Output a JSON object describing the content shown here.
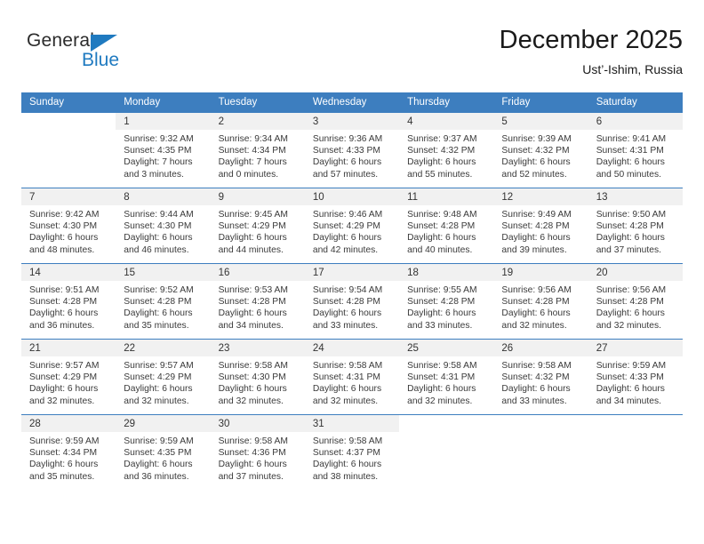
{
  "logo": {
    "word1": "General",
    "word2": "Blue",
    "triangle_color": "#1f7ac0"
  },
  "header": {
    "title": "December 2025",
    "subtitle": "Ust’-Ishim, Russia"
  },
  "theme": {
    "header_blue": "#3d7ebf",
    "daynum_band": "#f1f1f1",
    "text": "#3a3a3a"
  },
  "weekday_headers": [
    "Sunday",
    "Monday",
    "Tuesday",
    "Wednesday",
    "Thursday",
    "Friday",
    "Saturday"
  ],
  "weeks": [
    [
      {
        "day": "",
        "sunrise": "",
        "sunset": "",
        "daylight1": "",
        "daylight2": ""
      },
      {
        "day": "1",
        "sunrise": "Sunrise: 9:32 AM",
        "sunset": "Sunset: 4:35 PM",
        "daylight1": "Daylight: 7 hours",
        "daylight2": "and 3 minutes."
      },
      {
        "day": "2",
        "sunrise": "Sunrise: 9:34 AM",
        "sunset": "Sunset: 4:34 PM",
        "daylight1": "Daylight: 7 hours",
        "daylight2": "and 0 minutes."
      },
      {
        "day": "3",
        "sunrise": "Sunrise: 9:36 AM",
        "sunset": "Sunset: 4:33 PM",
        "daylight1": "Daylight: 6 hours",
        "daylight2": "and 57 minutes."
      },
      {
        "day": "4",
        "sunrise": "Sunrise: 9:37 AM",
        "sunset": "Sunset: 4:32 PM",
        "daylight1": "Daylight: 6 hours",
        "daylight2": "and 55 minutes."
      },
      {
        "day": "5",
        "sunrise": "Sunrise: 9:39 AM",
        "sunset": "Sunset: 4:32 PM",
        "daylight1": "Daylight: 6 hours",
        "daylight2": "and 52 minutes."
      },
      {
        "day": "6",
        "sunrise": "Sunrise: 9:41 AM",
        "sunset": "Sunset: 4:31 PM",
        "daylight1": "Daylight: 6 hours",
        "daylight2": "and 50 minutes."
      }
    ],
    [
      {
        "day": "7",
        "sunrise": "Sunrise: 9:42 AM",
        "sunset": "Sunset: 4:30 PM",
        "daylight1": "Daylight: 6 hours",
        "daylight2": "and 48 minutes."
      },
      {
        "day": "8",
        "sunrise": "Sunrise: 9:44 AM",
        "sunset": "Sunset: 4:30 PM",
        "daylight1": "Daylight: 6 hours",
        "daylight2": "and 46 minutes."
      },
      {
        "day": "9",
        "sunrise": "Sunrise: 9:45 AM",
        "sunset": "Sunset: 4:29 PM",
        "daylight1": "Daylight: 6 hours",
        "daylight2": "and 44 minutes."
      },
      {
        "day": "10",
        "sunrise": "Sunrise: 9:46 AM",
        "sunset": "Sunset: 4:29 PM",
        "daylight1": "Daylight: 6 hours",
        "daylight2": "and 42 minutes."
      },
      {
        "day": "11",
        "sunrise": "Sunrise: 9:48 AM",
        "sunset": "Sunset: 4:28 PM",
        "daylight1": "Daylight: 6 hours",
        "daylight2": "and 40 minutes."
      },
      {
        "day": "12",
        "sunrise": "Sunrise: 9:49 AM",
        "sunset": "Sunset: 4:28 PM",
        "daylight1": "Daylight: 6 hours",
        "daylight2": "and 39 minutes."
      },
      {
        "day": "13",
        "sunrise": "Sunrise: 9:50 AM",
        "sunset": "Sunset: 4:28 PM",
        "daylight1": "Daylight: 6 hours",
        "daylight2": "and 37 minutes."
      }
    ],
    [
      {
        "day": "14",
        "sunrise": "Sunrise: 9:51 AM",
        "sunset": "Sunset: 4:28 PM",
        "daylight1": "Daylight: 6 hours",
        "daylight2": "and 36 minutes."
      },
      {
        "day": "15",
        "sunrise": "Sunrise: 9:52 AM",
        "sunset": "Sunset: 4:28 PM",
        "daylight1": "Daylight: 6 hours",
        "daylight2": "and 35 minutes."
      },
      {
        "day": "16",
        "sunrise": "Sunrise: 9:53 AM",
        "sunset": "Sunset: 4:28 PM",
        "daylight1": "Daylight: 6 hours",
        "daylight2": "and 34 minutes."
      },
      {
        "day": "17",
        "sunrise": "Sunrise: 9:54 AM",
        "sunset": "Sunset: 4:28 PM",
        "daylight1": "Daylight: 6 hours",
        "daylight2": "and 33 minutes."
      },
      {
        "day": "18",
        "sunrise": "Sunrise: 9:55 AM",
        "sunset": "Sunset: 4:28 PM",
        "daylight1": "Daylight: 6 hours",
        "daylight2": "and 33 minutes."
      },
      {
        "day": "19",
        "sunrise": "Sunrise: 9:56 AM",
        "sunset": "Sunset: 4:28 PM",
        "daylight1": "Daylight: 6 hours",
        "daylight2": "and 32 minutes."
      },
      {
        "day": "20",
        "sunrise": "Sunrise: 9:56 AM",
        "sunset": "Sunset: 4:28 PM",
        "daylight1": "Daylight: 6 hours",
        "daylight2": "and 32 minutes."
      }
    ],
    [
      {
        "day": "21",
        "sunrise": "Sunrise: 9:57 AM",
        "sunset": "Sunset: 4:29 PM",
        "daylight1": "Daylight: 6 hours",
        "daylight2": "and 32 minutes."
      },
      {
        "day": "22",
        "sunrise": "Sunrise: 9:57 AM",
        "sunset": "Sunset: 4:29 PM",
        "daylight1": "Daylight: 6 hours",
        "daylight2": "and 32 minutes."
      },
      {
        "day": "23",
        "sunrise": "Sunrise: 9:58 AM",
        "sunset": "Sunset: 4:30 PM",
        "daylight1": "Daylight: 6 hours",
        "daylight2": "and 32 minutes."
      },
      {
        "day": "24",
        "sunrise": "Sunrise: 9:58 AM",
        "sunset": "Sunset: 4:31 PM",
        "daylight1": "Daylight: 6 hours",
        "daylight2": "and 32 minutes."
      },
      {
        "day": "25",
        "sunrise": "Sunrise: 9:58 AM",
        "sunset": "Sunset: 4:31 PM",
        "daylight1": "Daylight: 6 hours",
        "daylight2": "and 32 minutes."
      },
      {
        "day": "26",
        "sunrise": "Sunrise: 9:58 AM",
        "sunset": "Sunset: 4:32 PM",
        "daylight1": "Daylight: 6 hours",
        "daylight2": "and 33 minutes."
      },
      {
        "day": "27",
        "sunrise": "Sunrise: 9:59 AM",
        "sunset": "Sunset: 4:33 PM",
        "daylight1": "Daylight: 6 hours",
        "daylight2": "and 34 minutes."
      }
    ],
    [
      {
        "day": "28",
        "sunrise": "Sunrise: 9:59 AM",
        "sunset": "Sunset: 4:34 PM",
        "daylight1": "Daylight: 6 hours",
        "daylight2": "and 35 minutes."
      },
      {
        "day": "29",
        "sunrise": "Sunrise: 9:59 AM",
        "sunset": "Sunset: 4:35 PM",
        "daylight1": "Daylight: 6 hours",
        "daylight2": "and 36 minutes."
      },
      {
        "day": "30",
        "sunrise": "Sunrise: 9:58 AM",
        "sunset": "Sunset: 4:36 PM",
        "daylight1": "Daylight: 6 hours",
        "daylight2": "and 37 minutes."
      },
      {
        "day": "31",
        "sunrise": "Sunrise: 9:58 AM",
        "sunset": "Sunset: 4:37 PM",
        "daylight1": "Daylight: 6 hours",
        "daylight2": "and 38 minutes."
      },
      {
        "day": "",
        "sunrise": "",
        "sunset": "",
        "daylight1": "",
        "daylight2": ""
      },
      {
        "day": "",
        "sunrise": "",
        "sunset": "",
        "daylight1": "",
        "daylight2": ""
      },
      {
        "day": "",
        "sunrise": "",
        "sunset": "",
        "daylight1": "",
        "daylight2": ""
      }
    ]
  ]
}
